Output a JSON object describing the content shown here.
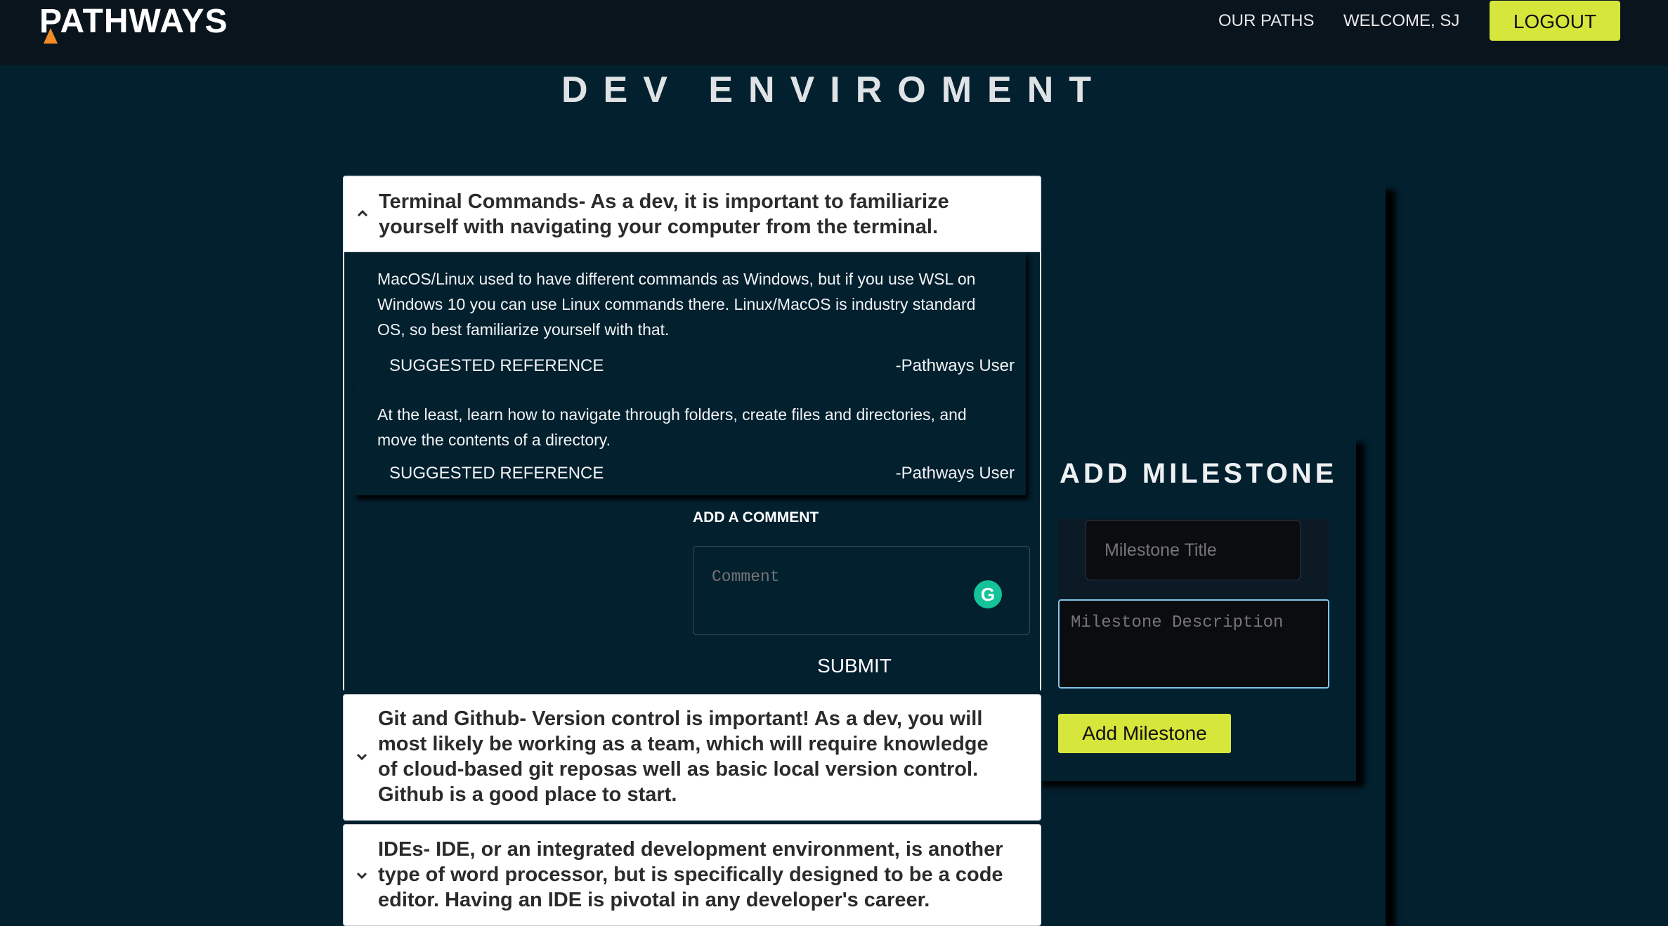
{
  "header": {
    "logo": "PATHWAYS",
    "nav": [
      "OUR PATHS",
      "WELCOME, SJ"
    ],
    "logout_label": "LOGOUT"
  },
  "page": {
    "title": "DEV ENVIROMENT"
  },
  "accordion": [
    {
      "title": "Terminal Commands- As a dev, it is important to familiarize yourself with navigating your computer from the terminal.",
      "expanded": true,
      "references": [
        {
          "text": "MacOS/Linux used to have different commands as Windows, but if you use WSL on Windows 10 you can use Linux commands there. Linux/MacOS is industry standard OS, so best familiarize yourself with that.",
          "link": "SUGGESTED REFERENCE",
          "author": "-Pathways User"
        },
        {
          "text": "At the least, learn how to navigate through folders, create files and directories, and move the contents of a directory.",
          "link": "SUGGESTED REFERENCE",
          "author": "-Pathways User"
        }
      ],
      "comment": {
        "label": "ADD A COMMENT",
        "placeholder": "Comment",
        "submit": "SUBMIT"
      }
    },
    {
      "title": "Git and Github- Version control is important! As a dev, you will most likely be working as a team, which will require knowledge of cloud-based git reposas well as basic local version control. Github is a good place to start.",
      "expanded": false
    },
    {
      "title": "IDEs- IDE, or an integrated development environment, is another type of word processor, but is specifically designed to be a code editor. Having an IDE is pivotal in any developer's career.",
      "expanded": false
    }
  ],
  "milestone": {
    "heading": "ADD MILESTONE",
    "title_placeholder": "Milestone Title",
    "description_placeholder": "Milestone Description",
    "button": "Add Milestone"
  },
  "colors": {
    "background": "#03202f",
    "topbar": "#0a141d",
    "accent": "#d6e63a",
    "logo_flame": "#f08b25",
    "focus_border": "#7fc4e6",
    "grammarly": "#15c39a"
  }
}
